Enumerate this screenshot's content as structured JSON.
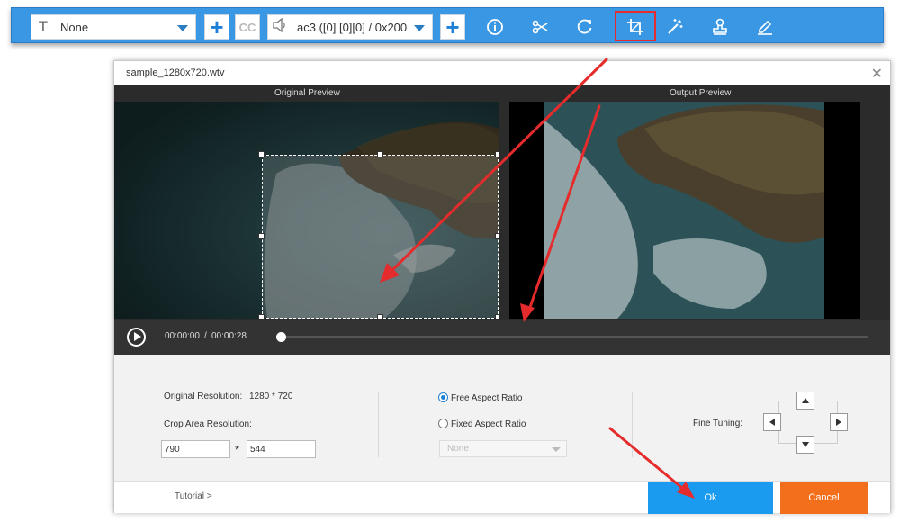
{
  "toolbar": {
    "subtitle_value": "None",
    "audio_value": "ac3 ([0] [0][0] / 0x200",
    "icons": [
      "text-icon",
      "add-subtitle-icon",
      "cc-icon",
      "speaker-icon",
      "add-audio-icon",
      "info-icon",
      "cut-icon",
      "rotate-icon",
      "crop-icon",
      "effects-icon",
      "watermark-icon",
      "edit-icon"
    ]
  },
  "dialog": {
    "title": "sample_1280x720.wtv",
    "original_preview_label": "Original Preview",
    "output_preview_label": "Output Preview"
  },
  "player": {
    "current_time": "00:00:00",
    "separator": "/",
    "total_time": "00:00:28"
  },
  "settings": {
    "original_resolution_label": "Original Resolution:",
    "original_resolution_value": "1280 * 720",
    "crop_area_label": "Crop Area Resolution:",
    "crop_width": "790",
    "crop_times": "*",
    "crop_height": "544",
    "free_aspect_label": "Free Aspect Ratio",
    "fixed_aspect_label": "Fixed Aspect Ratio",
    "aspect_dropdown_value": "None",
    "fine_tuning_label": "Fine Tuning:"
  },
  "footer": {
    "tutorial_link": "Tutorial >",
    "ok_label": "Ok",
    "cancel_label": "Cancel"
  },
  "colors": {
    "toolbar_blue": "#3a97e3",
    "ok_blue": "#1b9bf0",
    "cancel_orange": "#f36f1c",
    "annotation_red": "#e52b2b"
  }
}
